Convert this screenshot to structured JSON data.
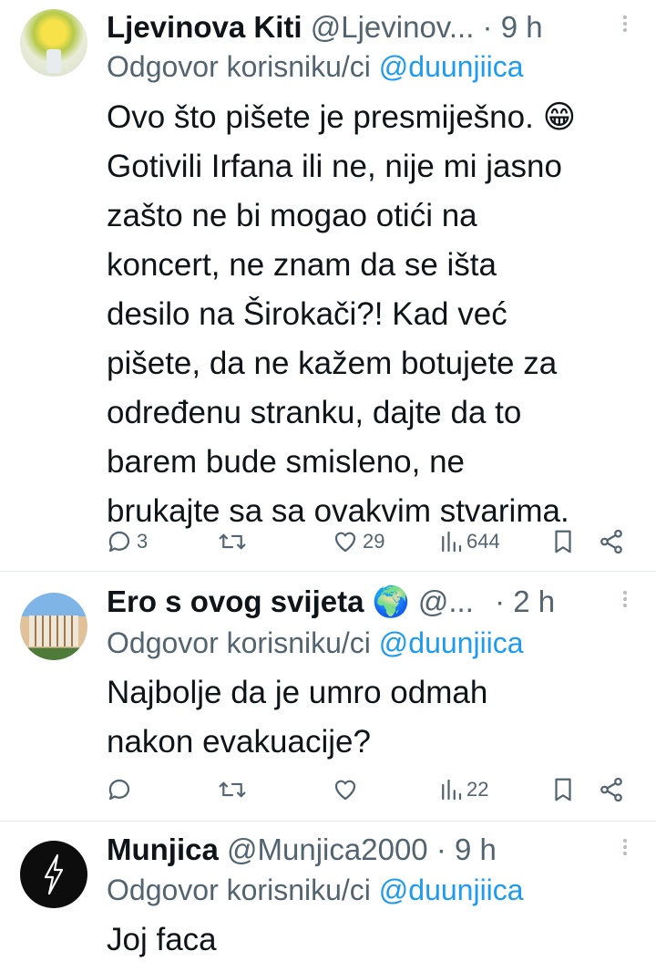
{
  "tweets": [
    {
      "name": "Ljevinova Kiti",
      "handle": "@Ljevinov...",
      "dot": "·",
      "time": "9 h",
      "reply_prefix": "Odgovor korisniku/ci ",
      "reply_to": "@duunjiica",
      "lines": [
        "Ovo što pišete je presmiješno.",
        "Gotivili Irfana ili ne, nije mi jasno",
        "zašto ne bi mogao otići na",
        "koncert, ne znam da se išta",
        "desilo na Širokači?! Kad već",
        "pišete, da ne kažem botujete za",
        "određenu stranku, dajte da to",
        "barem bude smisleno, ne",
        "brukajte sa sa ovakvim stvarima."
      ],
      "emoji": "😁",
      "replies": "3",
      "retweets": "",
      "likes": "29",
      "views": "644"
    },
    {
      "name": "Ero s ovog svijeta",
      "emoji_name": "🌍",
      "handle": "@...",
      "dot": "·",
      "time": "2 h",
      "reply_prefix": "Odgovor korisniku/ci ",
      "reply_to": "@duunjiica",
      "lines": [
        "Najbolje da je umro odmah",
        "nakon evakuacije?"
      ],
      "replies": "",
      "retweets": "",
      "likes": "",
      "views": "22"
    },
    {
      "name": "Munjica",
      "handle": "@Munjica2000",
      "dot": "·",
      "time": "9 h",
      "reply_prefix": "Odgovor korisniku/ci ",
      "reply_to": "@duunjiica",
      "lines": [
        "Joj faca"
      ]
    }
  ],
  "colors": {
    "accent": "#1d9bf0",
    "muted": "#536471",
    "text": "#0f1419",
    "divider": "#e6e9ec"
  }
}
